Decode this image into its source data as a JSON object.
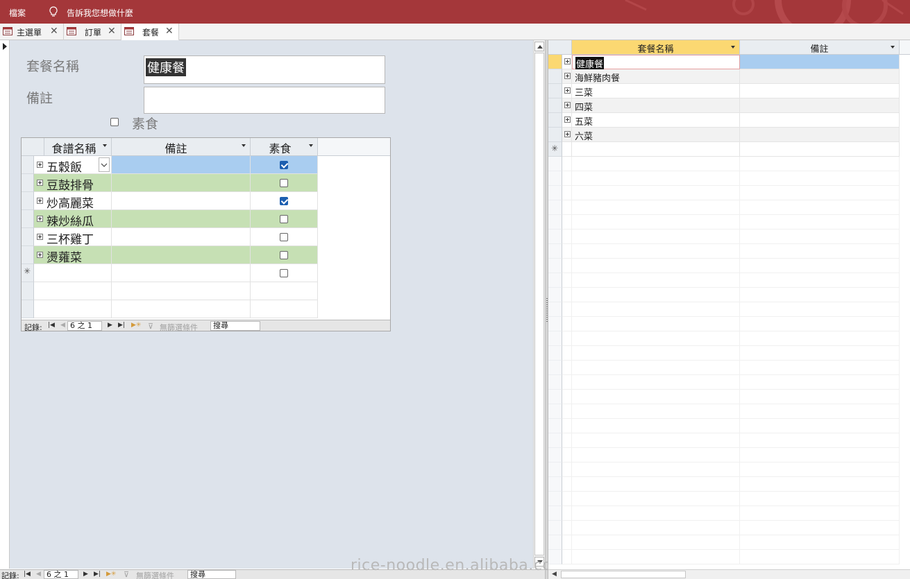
{
  "ribbon": {
    "file_label": "檔案",
    "tell_me": "告訴我您想做什麼"
  },
  "tabs": [
    {
      "label": "主選單",
      "close": "✕"
    },
    {
      "label": "訂單",
      "close": "✕"
    },
    {
      "label": "套餐",
      "close": "✕"
    }
  ],
  "form": {
    "name_label": "套餐名稱",
    "name_value": "健康餐",
    "note_label": "備註",
    "note_value": "",
    "vegetarian_label": "素食",
    "vegetarian_checked": false
  },
  "subform": {
    "headers": [
      "食譜名稱",
      "備註",
      "素食"
    ],
    "rows": [
      {
        "name": "五穀飯",
        "note": "",
        "veg": true
      },
      {
        "name": "豆鼓排骨",
        "note": "",
        "veg": false
      },
      {
        "name": "炒高麗菜",
        "note": "",
        "veg": true
      },
      {
        "name": "辣炒絲瓜",
        "note": "",
        "veg": false
      },
      {
        "name": "三杯雞丁",
        "note": "",
        "veg": false
      },
      {
        "name": "燙蕹菜",
        "note": "",
        "veg": false
      }
    ],
    "new_row_marker": "✳",
    "nav": {
      "record_label": "記錄:",
      "position": "6 之 1",
      "filter_label": "無篩選條件",
      "search_label": "搜尋"
    }
  },
  "form_nav": {
    "record_label": "記錄:",
    "position": "6 之 1",
    "filter_label": "無篩選條件",
    "search_label": "搜尋"
  },
  "datasheet": {
    "headers": [
      "套餐名稱",
      "備註"
    ],
    "rows": [
      {
        "name": "健康餐",
        "note": ""
      },
      {
        "name": "海鮮豬肉餐",
        "note": ""
      },
      {
        "name": "三菜",
        "note": ""
      },
      {
        "name": "四菜",
        "note": ""
      },
      {
        "name": "五菜",
        "note": ""
      },
      {
        "name": "六菜",
        "note": ""
      }
    ],
    "new_row_marker": "✳"
  },
  "watermark": "rice-noodle.en.alibaba.com",
  "colors": {
    "ribbon": "#a4373a",
    "form_background": "#dde3eb",
    "row_green": "#c6e0b4",
    "row_selected": "#a9cdf0",
    "header_highlight": "#fbd872",
    "checkbox_on": "#1d5fb0"
  }
}
